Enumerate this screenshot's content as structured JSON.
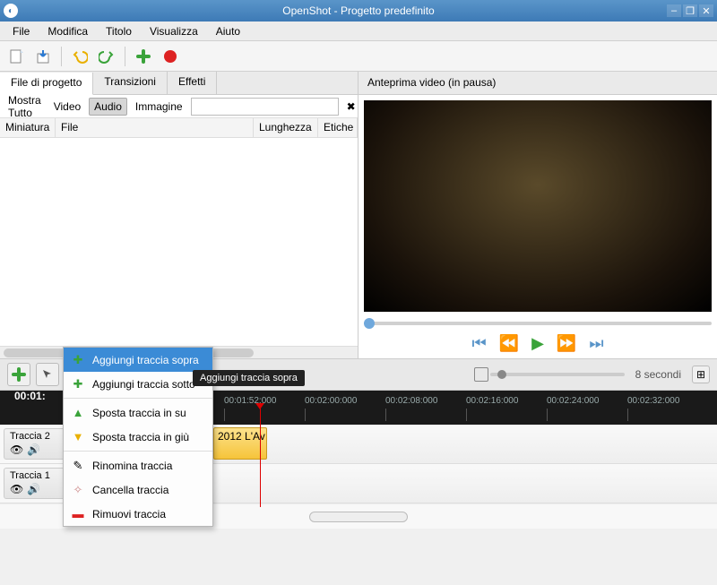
{
  "window": {
    "title": "OpenShot - Progetto predefinito"
  },
  "menu": {
    "items": [
      "File",
      "Modifica",
      "Titolo",
      "Visualizza",
      "Aiuto"
    ]
  },
  "toolbar": {
    "icons": [
      "new-file-icon",
      "import-icon",
      "undo-icon",
      "redo-icon",
      "add-icon",
      "record-icon"
    ]
  },
  "project_tabs": {
    "items": [
      "File di progetto",
      "Transizioni",
      "Effetti"
    ],
    "active": 0
  },
  "filter": {
    "show_all": "Mostra Tutto",
    "video": "Video",
    "audio": "Audio",
    "image": "Immagine",
    "selected": "Audio",
    "search": ""
  },
  "columns": {
    "thumb": "Miniatura",
    "file": "File",
    "length": "Lunghezza",
    "labels": "Etiche"
  },
  "preview": {
    "title": "Anteprima video (in pausa)"
  },
  "timeline_toolbar": {
    "zoom_label": "8 secondi"
  },
  "timeline": {
    "playhead_time": "00:01:",
    "ticks": [
      "00:01:52:000",
      "00:02:00:000",
      "00:02:08:000",
      "00:02:16:000",
      "00:02:24:000",
      "00:02:32:000"
    ]
  },
  "tracks": {
    "rows": [
      {
        "name": "Traccia 2",
        "clip": "2012 L'Av…"
      },
      {
        "name": "Traccia 1",
        "clip": ""
      }
    ]
  },
  "context_menu": {
    "items": [
      {
        "label": "Aggiungi traccia sopra",
        "icon": "plus",
        "hl": true
      },
      {
        "label": "Aggiungi traccia sotto",
        "icon": "plus"
      },
      {
        "label": "Sposta traccia in su",
        "icon": "arrow-up"
      },
      {
        "label": "Sposta traccia in giù",
        "icon": "arrow-down"
      },
      {
        "label": "Rinomina traccia",
        "icon": "pencil"
      },
      {
        "label": "Cancella traccia",
        "icon": "broom"
      },
      {
        "label": "Rimuovi traccia",
        "icon": "minus"
      }
    ],
    "tooltip": "Aggiungi traccia sopra"
  }
}
